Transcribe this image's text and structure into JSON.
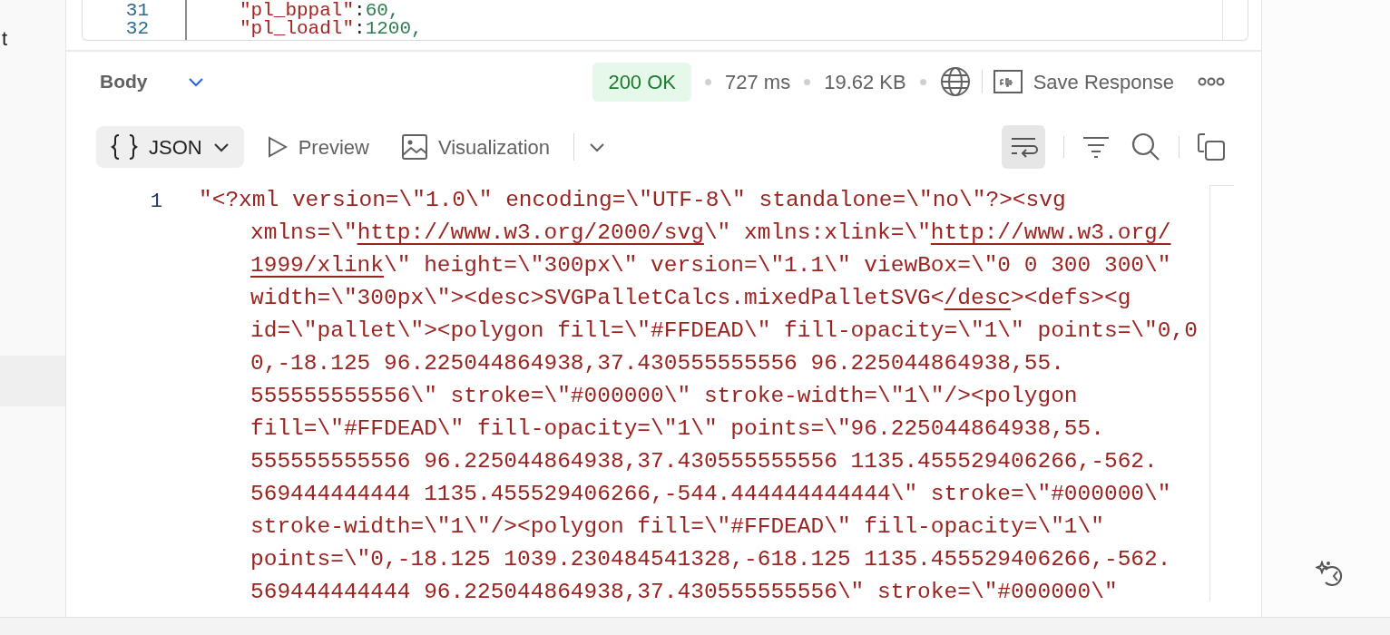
{
  "sidebar": {
    "items": [
      {
        "label": "t"
      }
    ]
  },
  "editor": {
    "lines": [
      {
        "number": "31",
        "key": "\"pl_bppal\"",
        "separator": ":",
        "value": "60,"
      },
      {
        "number": "32",
        "key": "\"pl_loadl\"",
        "separator": ":",
        "value": "1200,"
      }
    ]
  },
  "response": {
    "body_label": "Body",
    "status": "200 OK",
    "time": "727 ms",
    "size": "19.62 KB",
    "save_label": "Save Response",
    "view_tabs": [
      {
        "label": "JSON",
        "selected": true
      },
      {
        "label": "Preview",
        "selected": false
      },
      {
        "label": "Visualization",
        "selected": false
      }
    ],
    "word_wrap": {
      "on": true
    },
    "line_number": "1",
    "lines": [
      [
        {
          "text": "\"<?xml version=\\\"1.0\\\" encoding=\\\"UTF-8\\\" standalone=\\\"no\\\"?><svg",
          "link": false
        }
      ],
      [
        {
          "text": "xmlns=\\\"",
          "link": false
        },
        {
          "text": "http://www.w3.org/2000/svg",
          "link": true
        },
        {
          "text": "\\\" xmlns:xlink=\\\"",
          "link": false
        },
        {
          "text": "http://www.w3.org/",
          "link": true
        }
      ],
      [
        {
          "text": "1999/xlink",
          "link": true
        },
        {
          "text": "\\\" height=\\\"300px\\\" version=\\\"1.1\\\" viewBox=\\\"0 0 300 300\\\"",
          "link": false
        }
      ],
      [
        {
          "text": "width=\\\"300px\\\"><desc>SVGPalletCalcs.mixedPalletSVG<",
          "link": false
        },
        {
          "text": "/desc",
          "link": true
        },
        {
          "text": "><defs><g",
          "link": false
        }
      ],
      [
        {
          "text": "id=\\\"pallet\\\"><polygon fill=\\\"#FFDEAD\\\" fill-opacity=\\\"1\\\" points=\\\"0,0",
          "link": false
        }
      ],
      [
        {
          "text": "0,-18.125 96.225044864938,37.430555555556 96.225044864938,55.",
          "link": false
        }
      ],
      [
        {
          "text": "555555555556\\\" stroke=\\\"#000000\\\" stroke-width=\\\"1\\\"/><polygon",
          "link": false
        }
      ],
      [
        {
          "text": "fill=\\\"#FFDEAD\\\" fill-opacity=\\\"1\\\" points=\\\"96.225044864938,55.",
          "link": false
        }
      ],
      [
        {
          "text": "555555555556 96.225044864938,37.430555555556 1135.455529406266,-562.",
          "link": false
        }
      ],
      [
        {
          "text": "569444444444 1135.455529406266,-544.444444444444\\\" stroke=\\\"#000000\\\"",
          "link": false
        }
      ],
      [
        {
          "text": "stroke-width=\\\"1\\\"/><polygon fill=\\\"#FFDEAD\\\" fill-opacity=\\\"1\\\"",
          "link": false
        }
      ],
      [
        {
          "text": "points=\\\"0,-18.125 1039.230484541328,-618.125 1135.455529406266,-562.",
          "link": false
        }
      ],
      [
        {
          "text": "569444444444 96.225044864938,37.430555555556\\\" stroke=\\\"#000000\\\"",
          "link": false
        }
      ]
    ]
  }
}
